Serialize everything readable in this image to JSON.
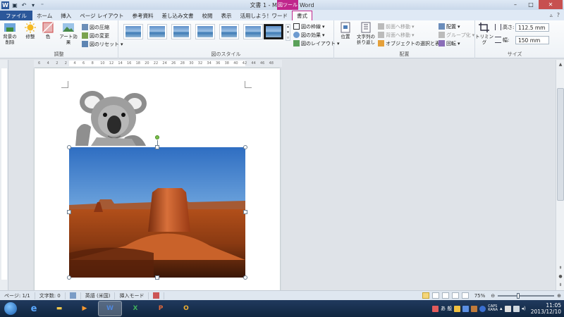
{
  "window": {
    "title": "文書 1 - Microsoft Word",
    "tool_tab_title": "図ツール",
    "buttons": {
      "minimize": "–",
      "maximize": "□",
      "close": "✕"
    }
  },
  "tabs": [
    {
      "label": "ファイル",
      "kind": "file"
    },
    {
      "label": "ホーム"
    },
    {
      "label": "挿入"
    },
    {
      "label": "ページ レイアウト"
    },
    {
      "label": "参考資料"
    },
    {
      "label": "差し込み文書"
    },
    {
      "label": "校閲"
    },
    {
      "label": "表示"
    },
    {
      "label": "活用しよう！ワード"
    },
    {
      "label": "書式",
      "kind": "active"
    }
  ],
  "ribbon": {
    "adjust": {
      "label": "調整",
      "remove_bg": "背景の\n削除",
      "correct": "修整",
      "color": "色",
      "art_effects": "アート効果",
      "compress": "図の圧縮",
      "change": "図の変更",
      "reset": "図のリセット"
    },
    "styles": {
      "label": "図のスタイル",
      "border": "図の枠線",
      "effects": "図の効果",
      "layout": "図のレイアウト"
    },
    "arrange": {
      "label": "配置",
      "position": "位置",
      "wrap": "文字列の\n折り返し",
      "forward": "前面へ移動",
      "backward": "背面へ移動",
      "selection": "オブジェクトの選択と表示",
      "align": "配置",
      "group": "グループ化",
      "rotate": "回転"
    },
    "size": {
      "label": "サイズ",
      "crop": "トリミング",
      "height_label": "高さ:",
      "height_value": "112.5 mm",
      "width_label": "幅:",
      "width_value": "150 mm"
    }
  },
  "ruler_ticks": [
    "6",
    "4",
    "2",
    "2",
    "4",
    "6",
    "8",
    "10",
    "12",
    "14",
    "16",
    "18",
    "20",
    "22",
    "24",
    "26",
    "28",
    "30",
    "32",
    "34",
    "36",
    "38",
    "40",
    "42",
    "44",
    "46",
    "48"
  ],
  "statusbar": {
    "page": "ページ: 1/1",
    "words": "文字数: 0",
    "language": "英語 (米国)",
    "mode": "挿入モード",
    "zoom": "75%",
    "zoom_level": 0.35
  },
  "taskbar": {
    "tray_text": "あ 般",
    "caps": "CAPS\nKANA",
    "time": "11:05",
    "date": "2013/12/10"
  },
  "colors": {
    "accent_blue": "#2b579a",
    "tool_tab_magenta": "#c0268c",
    "taskbar": "#102640"
  }
}
